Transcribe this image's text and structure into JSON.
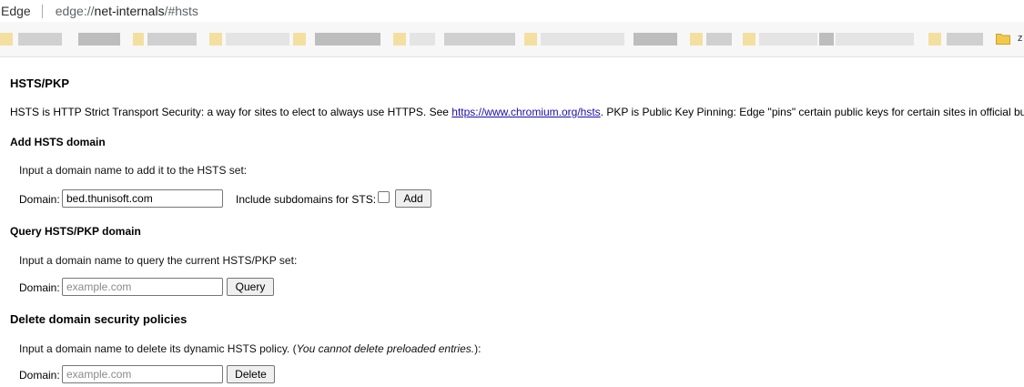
{
  "browser": {
    "site_name": "Edge",
    "url": {
      "scheme": "edge://",
      "host": "net-internals",
      "path": "/#hsts"
    },
    "bookmarks_overflow_label": "z"
  },
  "page": {
    "title": "HSTS/PKP",
    "description": {
      "before_link": "HSTS is HTTP Strict Transport Security: a way for sites to elect to always use HTTPS. See ",
      "link": "https://www.chromium.org/hsts",
      "after_link": ". PKP is Public Key Pinning: Edge \"pins\" certain public keys for certain sites in official builds."
    },
    "add_section": {
      "title": "Add HSTS domain",
      "hint": "Input a domain name to add it to the HSTS set:",
      "domain_label": "Domain:",
      "domain_value": "bed.thunisoft.com",
      "subdomains_label": "Include subdomains for STS:",
      "subdomains_checked": false,
      "button_label": "Add"
    },
    "query_section": {
      "title": "Query HSTS/PKP domain",
      "hint": "Input a domain name to query the current HSTS/PKP set:",
      "domain_label": "Domain:",
      "domain_placeholder": "example.com",
      "button_label": "Query"
    },
    "delete_section": {
      "title": "Delete domain security policies",
      "hint_before": "Input a domain name to delete its dynamic HSTS policy. (",
      "hint_italic": "You cannot delete preloaded entries.",
      "hint_after": "):",
      "domain_label": "Domain:",
      "domain_placeholder": "example.com",
      "button_label": "Delete"
    }
  }
}
